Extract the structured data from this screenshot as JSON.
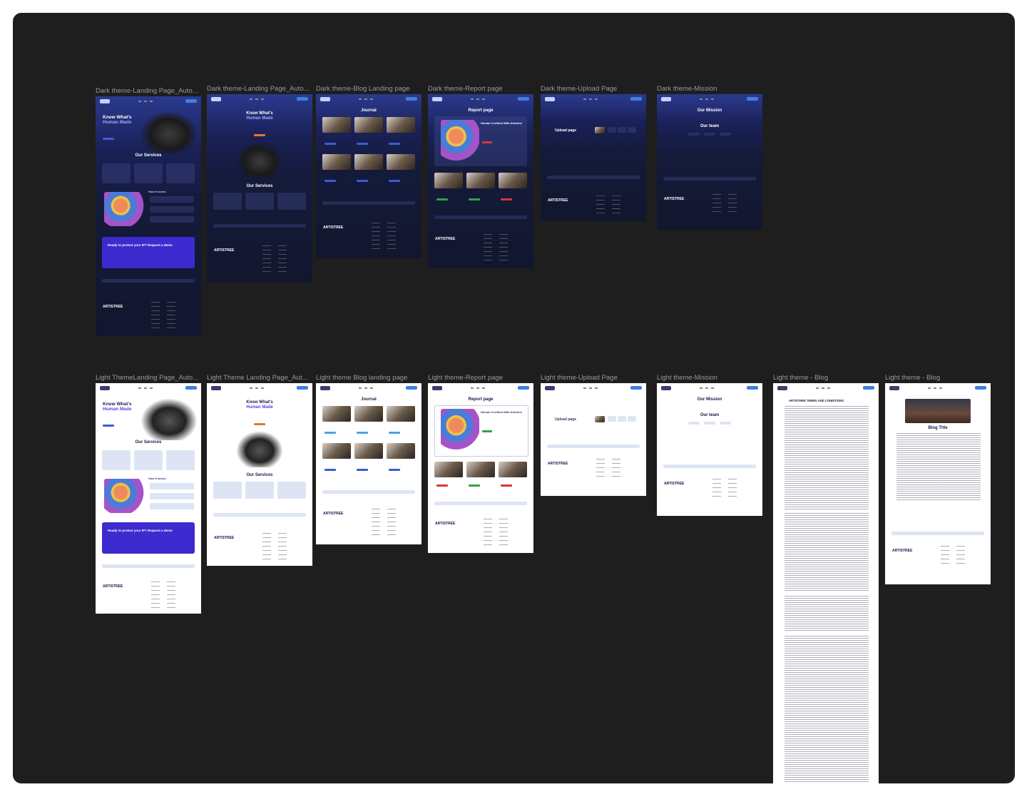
{
  "canvas": {
    "background": "#1e1e1e"
  },
  "dark_frames": [
    {
      "label": "Dark theme-Landing Page_Auto...",
      "title": "Know What's",
      "title2": "Human Made",
      "section": "Our Services",
      "section2": "How it works",
      "cta": "Ready to protect your IP? Request a demo"
    },
    {
      "label": "Dark theme-Landing Page_Auto...",
      "title": "Know What's",
      "title2": "Human Made",
      "section": "Our Services"
    },
    {
      "label": "Dark theme-Blog Landing page",
      "title": "Journal"
    },
    {
      "label": "Dark theme-Report page",
      "title": "Report page",
      "sub": "Human Certified With Artistree"
    },
    {
      "label": "Dark theme-Upload Page",
      "title": "Upload page"
    },
    {
      "label": "Dark theme-Mission",
      "title": "Our Mission",
      "sub": "Our team"
    }
  ],
  "light_frames": [
    {
      "label": "Light ThemeLanding Page_Auto...",
      "title": "Know What's",
      "title2": "Human Made",
      "section": "Our Services",
      "section2": "How it works",
      "cta": "Ready to protect your IP? Request a demo"
    },
    {
      "label": "Light Theme Landing Page_Aut...",
      "title": "Know What's",
      "title2": "Human Made",
      "section": "Our Services"
    },
    {
      "label": "Light theme Blog landing page",
      "title": "Journal"
    },
    {
      "label": "Light theme-Report page",
      "title": "Report page",
      "sub": "Human Certified With Artistree"
    },
    {
      "label": "Light theme-Upload Page",
      "title": "Upload page"
    },
    {
      "label": "Light theme-Mission",
      "title": "Our Mission",
      "sub": "Our team"
    },
    {
      "label": "Light theme - Blog",
      "title": "ARTISTREE TERMS AND CONDITIONS"
    },
    {
      "label": "Light theme - Blog",
      "title": "Blog Title"
    }
  ],
  "footer": {
    "brand": "ARTISTREE"
  },
  "colors": {
    "accent": "#3d2bd0",
    "button_blue": "#3f7fe0",
    "orange": "#e07a2c",
    "green": "#2fa34a",
    "red": "#d03a3a"
  }
}
